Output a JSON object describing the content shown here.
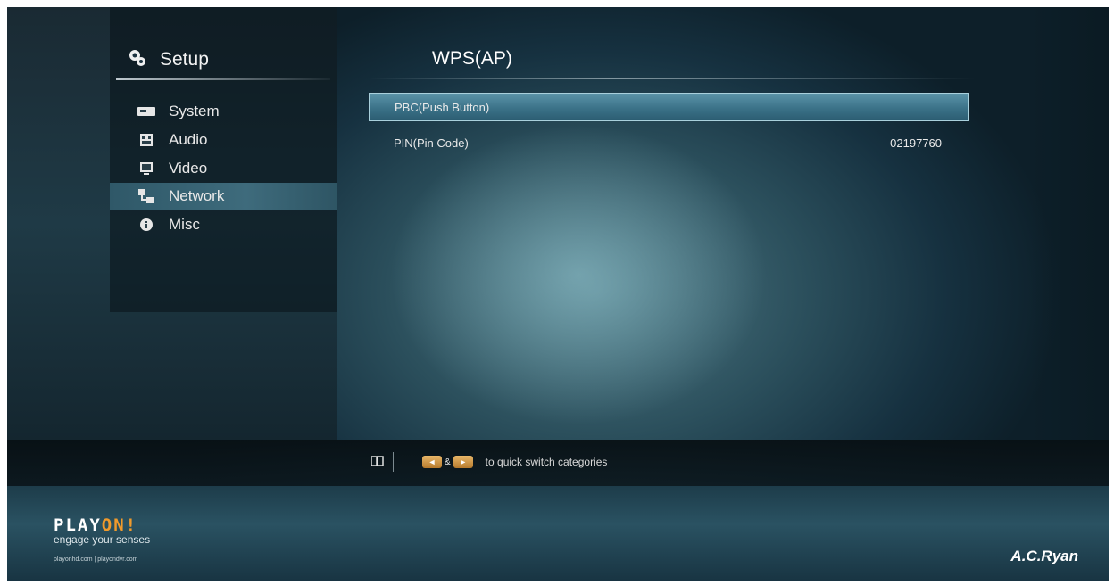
{
  "sidebar": {
    "title": "Setup",
    "items": [
      {
        "label": "System",
        "icon": "system-icon"
      },
      {
        "label": "Audio",
        "icon": "audio-icon"
      },
      {
        "label": "Video",
        "icon": "video-icon"
      },
      {
        "label": "Network",
        "icon": "network-icon",
        "active": true
      },
      {
        "label": "Misc",
        "icon": "info-icon"
      }
    ]
  },
  "main": {
    "title": "WPS(AP)",
    "options": [
      {
        "label": "PBC(Push Button)",
        "value": "",
        "selected": true
      },
      {
        "label": "PIN(Pin Code)",
        "value": "02197760",
        "selected": false
      }
    ]
  },
  "footer": {
    "hint_left_key": "◄",
    "hint_amp": "&",
    "hint_right_key": "►",
    "hint_text": "to quick switch categories"
  },
  "branding": {
    "logo_main": "PLAY",
    "logo_accent": "ON!",
    "tagline": "engage your senses",
    "sites": "playonhd.com | playondvr.com",
    "brand": "A.C.Ryan"
  },
  "colors": {
    "accent_orange": "#f09a2c",
    "selection_blue": "#3b7288"
  }
}
